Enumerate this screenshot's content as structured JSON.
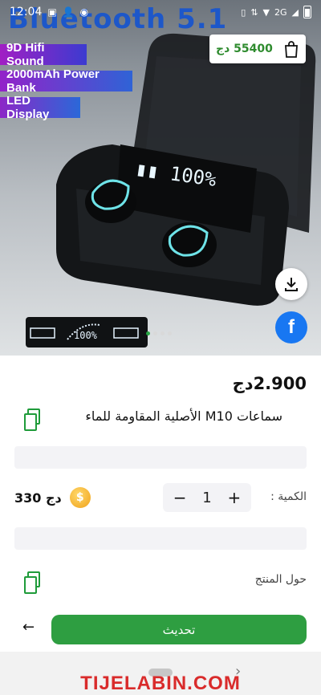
{
  "status_bar": {
    "time": "12:04",
    "network": "2G"
  },
  "hero": {
    "banner_title": "Bluetooth 5.1",
    "features": [
      "9D Hifi Sound",
      "2000mAh Power Bank",
      "LED Display"
    ],
    "cart_price": "55400 دج",
    "carousel": {
      "count": 4,
      "active": 0
    }
  },
  "product": {
    "price": "2.900دج",
    "title": "سماعات M10 الأصلية المقاومة للماء",
    "points_value": "330 دج",
    "quantity_label": "الكمية :",
    "quantity": "1",
    "about_label": "حول المنتج"
  },
  "actions": {
    "update_label": "تحديث"
  },
  "watermark": "TIJELABIN.COM",
  "colors": {
    "accent_green": "#2e9e41",
    "facebook_blue": "#1877f2"
  }
}
